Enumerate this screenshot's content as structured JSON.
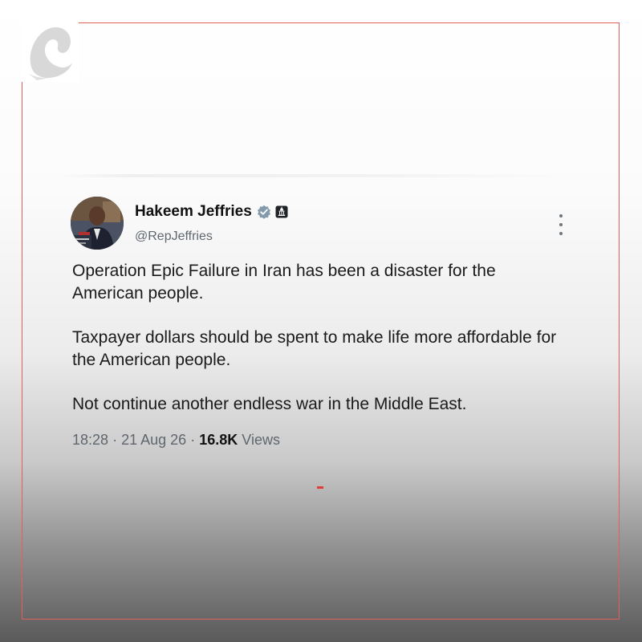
{
  "colors": {
    "frame": "#e06060",
    "verified_badge": "#829aab",
    "text_primary": "#1a1a1a",
    "text_secondary": "#5f666d",
    "accent_dash": "#e23b3b"
  },
  "icons": {
    "logo": "abstract-white-swirl-logo",
    "verified": "verified-badge-icon",
    "government": "government-capitol-icon",
    "more": "more-vertical-icon"
  },
  "tweet": {
    "display_name": "Hakeem Jeffries",
    "handle": "@RepJeffries",
    "paragraphs": [
      "Operation Epic Failure in Iran has been a disaster for the American people.",
      "Taxpayer dollars should be spent to make life more affordable for the American people.",
      "Not continue another endless war in the Middle East."
    ],
    "time": "18:28",
    "date": "21 Aug 26",
    "separator": "·",
    "views_count": "16.8K",
    "views_label": "Views"
  }
}
